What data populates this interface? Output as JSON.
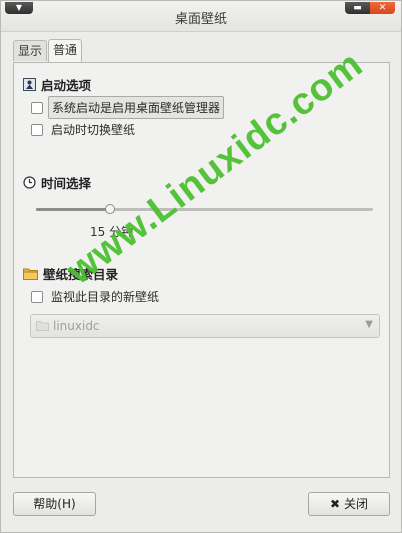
{
  "window": {
    "title": "桌面壁纸",
    "menu_icon": "menu-arrow-icon",
    "minimize_icon": "minimize-icon",
    "close_icon": "close-x-icon",
    "close_color": "#e0512a"
  },
  "tabs": [
    {
      "label": "显示",
      "active": false
    },
    {
      "label": "普通",
      "active": true
    }
  ],
  "startup": {
    "heading": "启动选项",
    "icon": "startup-icon",
    "options": [
      {
        "label": "系统启动是启用桌面壁纸管理器",
        "checked": false
      },
      {
        "label": "启动时切换壁纸",
        "checked": false
      }
    ]
  },
  "time": {
    "heading": "时间选择",
    "icon": "clock-icon",
    "slider_fraction": 0.22,
    "value_text": "15 分钟"
  },
  "folder": {
    "heading": "壁纸搜索目录",
    "icon": "folder-icon",
    "option": {
      "label": "监视此目录的新壁纸",
      "checked": false
    },
    "combo_value": "linuxidc",
    "combo_icon": "folder-icon"
  },
  "buttons": {
    "help": "帮助(H)",
    "close": "关闭",
    "close_icon": "close-x-icon"
  },
  "watermark": "www.Linuxidc.com"
}
